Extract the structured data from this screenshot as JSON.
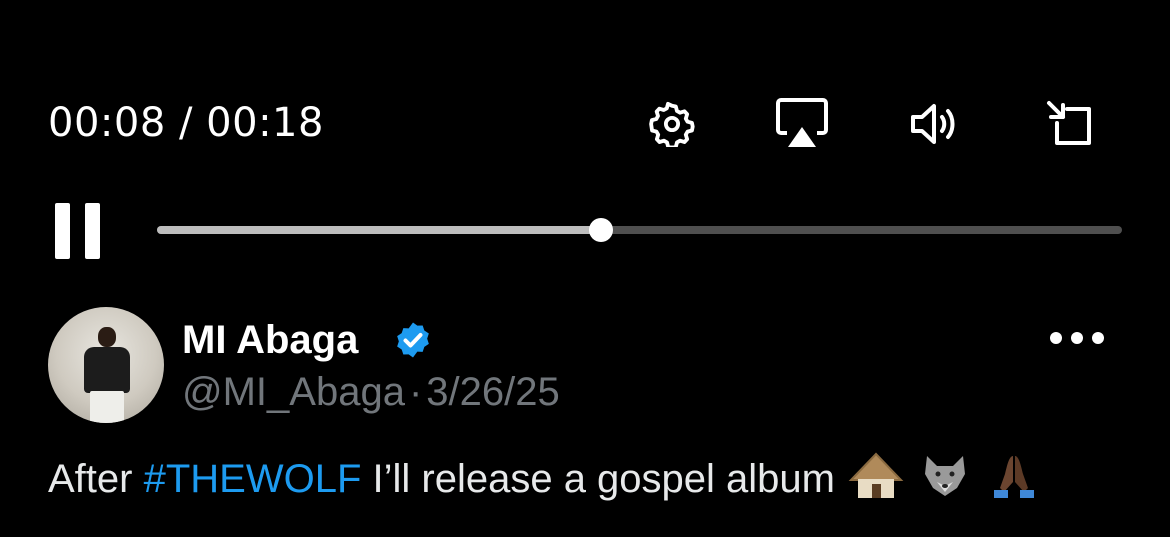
{
  "player": {
    "time_display": "00:08 / 00:18",
    "progress_fraction": 0.46,
    "controls": [
      {
        "name": "settings",
        "icon": "gear-icon"
      },
      {
        "name": "airplay",
        "icon": "airplay-icon"
      },
      {
        "name": "volume",
        "icon": "speaker-icon"
      },
      {
        "name": "pip",
        "icon": "picture-in-picture-icon"
      }
    ]
  },
  "tweet": {
    "author_name": "MI Abaga",
    "verified": true,
    "handle": "@MI_Abaga",
    "separator": "·",
    "date": "3/26/25",
    "text_before": "After ",
    "hashtag": "#THEWOLF",
    "text_after": " I’ll release a gospel album",
    "emojis": [
      "hut",
      "wolf",
      "folded-hands"
    ]
  },
  "colors": {
    "background": "#000000",
    "accent": "#1d9bf0",
    "secondary_text": "#71767b"
  }
}
